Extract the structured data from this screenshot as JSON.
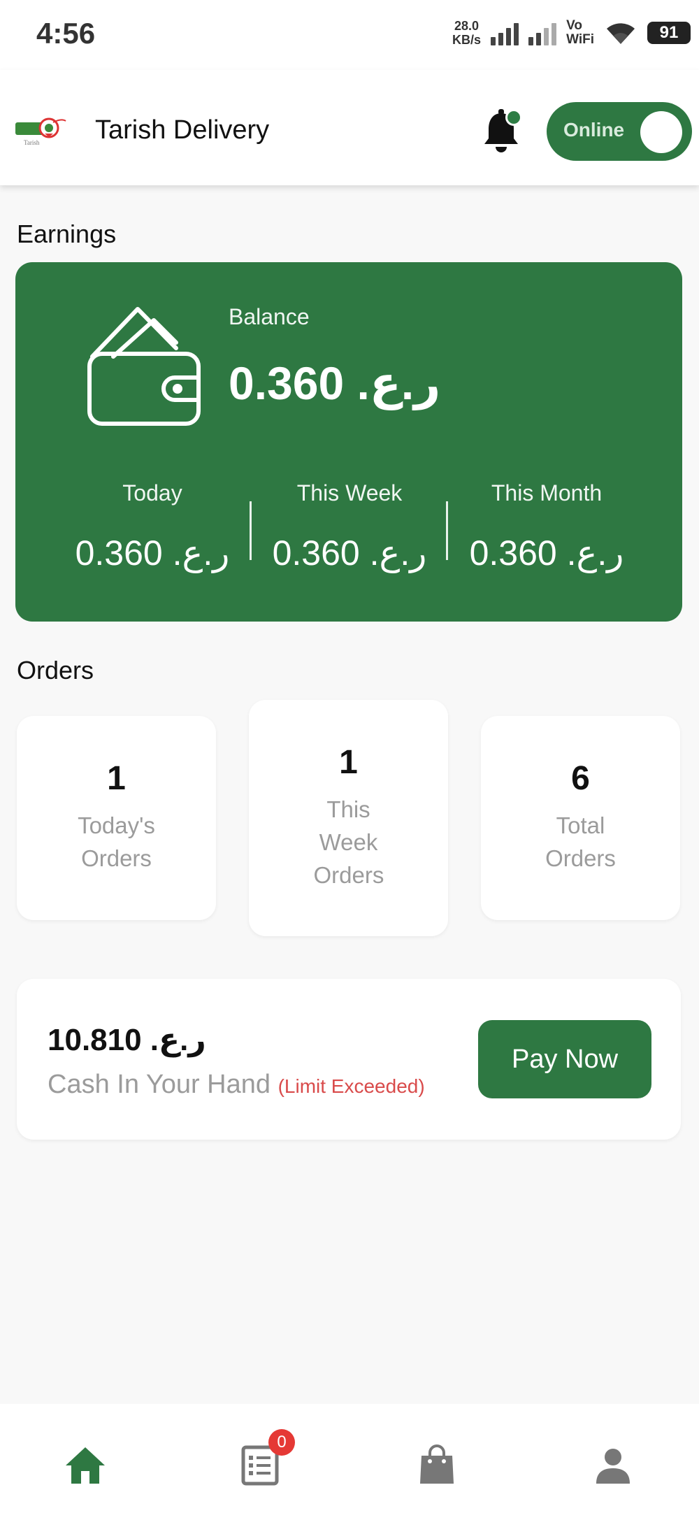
{
  "status_bar": {
    "time": "4:56",
    "net_speed_value": "28.0",
    "net_speed_unit": "KB/s",
    "vo_label": "Vo",
    "wifi_label": "WiFi",
    "battery": "91"
  },
  "app_bar": {
    "logo_text": "Tarish",
    "title": "Tarish Delivery",
    "toggle_label": "Online"
  },
  "earnings": {
    "section_title": "Earnings",
    "balance_label": "Balance",
    "balance_value": "0.360 .ر.ع",
    "periods": [
      {
        "label": "Today",
        "value": "0.360 .ر.ع"
      },
      {
        "label": "This Week",
        "value": "0.360 .ر.ع"
      },
      {
        "label": "This Month",
        "value": "0.360 .ر.ع"
      }
    ]
  },
  "orders": {
    "section_title": "Orders",
    "cards": [
      {
        "count": "1",
        "label": "Today's Orders"
      },
      {
        "count": "1",
        "label": "This Week Orders"
      },
      {
        "count": "6",
        "label": "Total Orders"
      }
    ]
  },
  "cash": {
    "amount": "10.810 .ر.ع",
    "label": "Cash In Your Hand",
    "warning": "(Limit Exceeded)",
    "pay_button": "Pay Now"
  },
  "bottom_nav": {
    "orders_badge": "0",
    "items": [
      "home-icon",
      "orders-list-icon",
      "shopping-bag-icon",
      "profile-icon"
    ]
  },
  "colors": {
    "primary": "#2e7842",
    "warning": "#d94b4b",
    "badge": "#e53935"
  }
}
